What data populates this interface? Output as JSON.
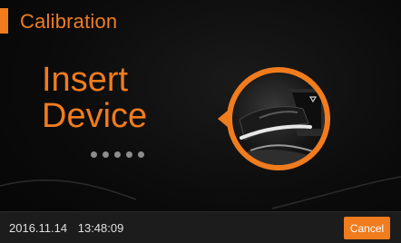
{
  "title": "Calibration",
  "instruction": {
    "line1": "Insert",
    "line2": "Device"
  },
  "progress_dots": {
    "count": 5
  },
  "illustration": {
    "icon": "device-insert-icon",
    "slot_marker": "triangle-down-icon"
  },
  "status": {
    "date": "2016.11.14",
    "time": "13:48:09"
  },
  "actions": {
    "cancel_label": "Cancel"
  },
  "colors": {
    "accent": "#f07c1e",
    "background": "#0b0b0b",
    "bottom_bar": "#1c1c1c"
  }
}
